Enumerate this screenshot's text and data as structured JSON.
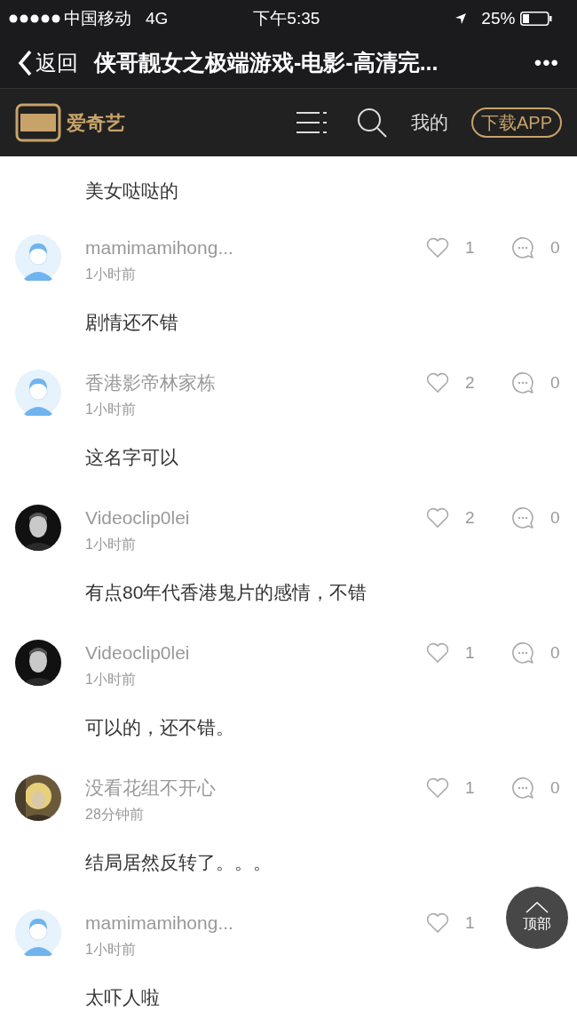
{
  "status_bar": {
    "carrier": "中国移动",
    "network": "4G",
    "time": "下午5:35",
    "battery": "25%"
  },
  "nav_bar": {
    "back": "返回",
    "title": "侠哥靓女之极端游戏-电影-高清完...",
    "more": "•••"
  },
  "site_header": {
    "logo_text": "爱奇艺",
    "my": "我的",
    "download": "下载APP"
  },
  "comments": [
    {
      "text": "美女哒哒的"
    },
    {
      "user": "mamimamihong...",
      "avatar": {
        "kind": "default"
      },
      "time": "1小时前",
      "likes": "1",
      "replies": "0",
      "text": "剧情还不错"
    },
    {
      "user": "香港影帝林家栋",
      "avatar": {
        "kind": "default"
      },
      "time": "1小时前",
      "likes": "2",
      "replies": "0",
      "text": "这名字可以"
    },
    {
      "user": "Videoclip0lei",
      "time": "1小时前",
      "likes": "2",
      "replies": "0",
      "text": "有点80年代香港鬼片的感情，不错"
    },
    {
      "user": "Videoclip0lei",
      "time": "1小时前",
      "likes": "1",
      "replies": "0",
      "text": "可以的，还不错。"
    },
    {
      "user": "没看花组不开心",
      "avatar": {
        "kind": "photo_warm"
      },
      "time": "28分钟前",
      "likes": "1",
      "replies": "0",
      "text": "结局居然反转了。。。"
    },
    {
      "user": "mamimamihong...",
      "avatar": {
        "kind": "default"
      },
      "time": "1小时前",
      "likes": "1",
      "text": "太吓人啦"
    }
  ],
  "top_button": {
    "label": "顶部"
  }
}
